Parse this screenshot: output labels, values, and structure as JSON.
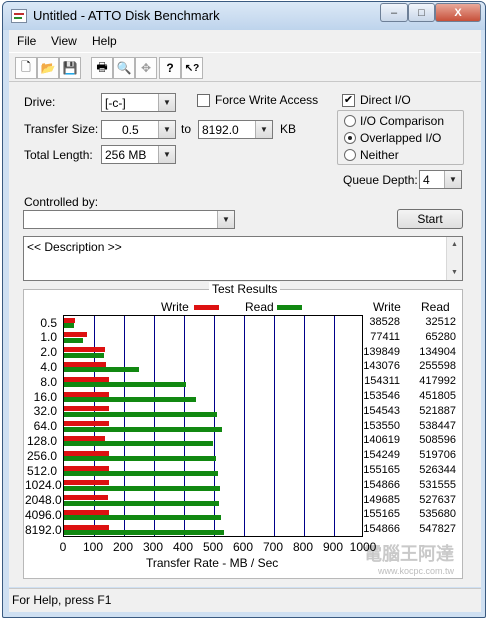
{
  "window": {
    "title": "Untitled - ATTO Disk Benchmark",
    "minimize_label": "–",
    "maximize_label": "□",
    "close_label": "X"
  },
  "menu": {
    "file_label": "File",
    "view_label": "View",
    "help_label": "Help"
  },
  "toolbar": {
    "buttons": [
      {
        "name": "new-icon",
        "glyph": "🗋"
      },
      {
        "name": "open-icon",
        "glyph": "📂"
      },
      {
        "name": "save-icon",
        "glyph": "💾"
      },
      {
        "name": "print-icon",
        "glyph": "🖶"
      },
      {
        "name": "print-preview-icon",
        "glyph": "🔍"
      },
      {
        "name": "move-icon",
        "glyph": "✥"
      },
      {
        "name": "help-icon",
        "glyph": "?"
      },
      {
        "name": "context-help-icon",
        "glyph": "↖?"
      }
    ]
  },
  "settings": {
    "drive_label": "Drive:",
    "drive_value": "[-c-]",
    "force_write_label": "Force Write Access",
    "force_write_checked": false,
    "direct_io_label": "Direct I/O",
    "direct_io_checked": true,
    "transfer_size_label": "Transfer Size:",
    "transfer_from": "0.5",
    "to_label": "to",
    "transfer_to": "8192.0",
    "kb_label": "KB",
    "total_length_label": "Total Length:",
    "total_length_value": "256 MB",
    "io_options": [
      {
        "label": "I/O Comparison",
        "selected": false
      },
      {
        "label": "Overlapped I/O",
        "selected": true
      },
      {
        "label": "Neither",
        "selected": false
      }
    ],
    "queue_depth_label": "Queue Depth:",
    "queue_depth_value": "4",
    "controlled_by_label": "Controlled by:",
    "controlled_by_value": "",
    "start_label": "Start",
    "description_text": "<< Description >>"
  },
  "results": {
    "title": "Test Results",
    "write_legend": "Write",
    "read_legend": "Read",
    "write_header": "Write",
    "read_header": "Read",
    "colors": {
      "write": "#dd1111",
      "read": "#118811"
    }
  },
  "chart_data": {
    "type": "bar",
    "title": "Test Results",
    "xlabel": "Transfer Rate - MB / Sec",
    "xlim": [
      0,
      1000
    ],
    "xticks": [
      "0",
      "100",
      "200",
      "300",
      "400",
      "500",
      "600",
      "700",
      "800",
      "900",
      "1000"
    ],
    "grid": true,
    "legend_placement": "top",
    "categories": [
      "0.5",
      "1.0",
      "2.0",
      "4.0",
      "8.0",
      "16.0",
      "32.0",
      "64.0",
      "128.0",
      "256.0",
      "512.0",
      "1024.0",
      "2048.0",
      "4096.0",
      "8192.0"
    ],
    "series": [
      {
        "name": "Write",
        "values": [
          38528,
          77411,
          139849,
          143076,
          154311,
          153546,
          154543,
          153550,
          140619,
          154249,
          155165,
          154866,
          149685,
          155165,
          154866
        ]
      },
      {
        "name": "Read",
        "values": [
          32512,
          65280,
          134904,
          255598,
          417992,
          451805,
          521887,
          538447,
          508596,
          519706,
          526344,
          531555,
          527637,
          535680,
          547827
        ]
      }
    ]
  },
  "status": {
    "text": "For Help, press F1"
  },
  "watermark": {
    "text": "電腦王阿達",
    "url": "www.kocpc.com.tw"
  }
}
